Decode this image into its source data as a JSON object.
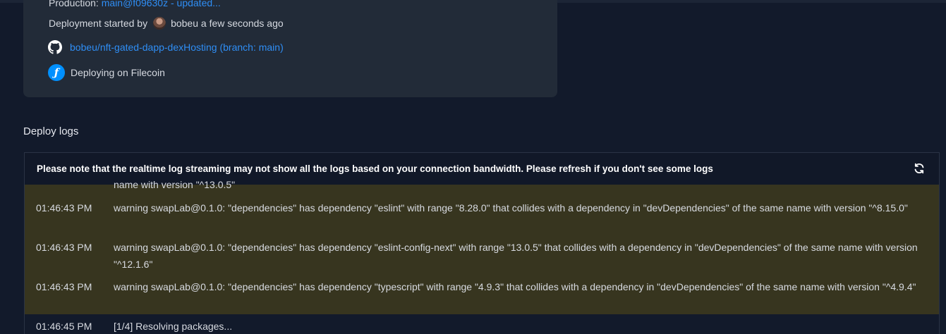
{
  "deployment": {
    "production_label": "Production:",
    "production_link": "main@f09630z - updated...",
    "started_prefix": "Deployment started by",
    "started_user": "bobeu",
    "started_time": "a few seconds ago",
    "repo_link": "bobeu/nft-gated-dapp-dexHosting (branch: main)",
    "deploy_target": "Deploying on Filecoin"
  },
  "deploy_logs": {
    "title": "Deploy logs",
    "notice": "Please note that the realtime log streaming may not show all the logs based on your connection bandwidth. Please refresh if you don't see some logs",
    "clipped_line": "name with version \"^13.0.5\"",
    "entries": [
      {
        "time": "01:46:43 PM",
        "message": "warning swapLab@0.1.0: \"dependencies\" has dependency \"eslint\" with range \"8.28.0\" that collides with a dependency in \"devDependencies\" of the same name with version \"^8.15.0\""
      },
      {
        "time": "01:46:43 PM",
        "message": "warning swapLab@0.1.0: \"dependencies\" has dependency \"eslint-config-next\" with range \"13.0.5\" that collides with a dependency in \"devDependencies\" of the same name with version \"^12.1.6\""
      },
      {
        "time": "01:46:43 PM",
        "message": "warning swapLab@0.1.0: \"dependencies\" has dependency \"typescript\" with range \"4.9.3\" that collides with a dependency in \"devDependencies\" of the same name with version \"^4.9.4\""
      },
      {
        "time": "01:46:45 PM",
        "message": "[1/4] Resolving packages..."
      }
    ]
  },
  "icons": {
    "github": "github-icon",
    "filecoin": "filecoin-icon",
    "refresh": "refresh-icon"
  }
}
